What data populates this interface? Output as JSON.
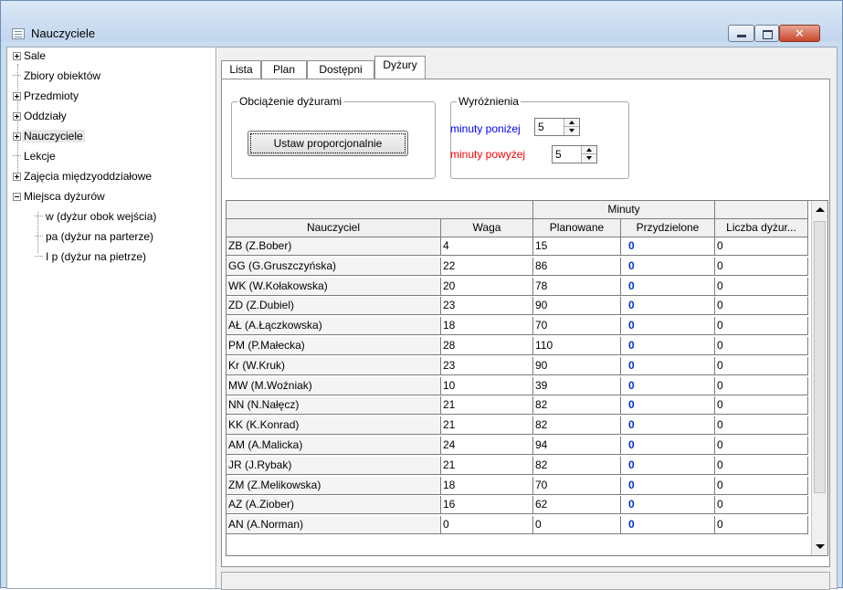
{
  "window": {
    "title": "Nauczyciele"
  },
  "tree": {
    "items": [
      {
        "label": "Sale",
        "expander": "plus"
      },
      {
        "label": "Zbiory obiektów",
        "expander": "line"
      },
      {
        "label": "Przedmioty",
        "expander": "plus"
      },
      {
        "label": "Oddziały",
        "expander": "plus"
      },
      {
        "label": "Nauczyciele",
        "expander": "plus",
        "selected": true
      },
      {
        "label": "Lekcje",
        "expander": "line"
      },
      {
        "label": "Zajęcia międzyoddziałowe",
        "expander": "plus"
      },
      {
        "label": "Miejsca dyżurów",
        "expander": "minus"
      },
      {
        "label": "w (dyżur obok wejścia)",
        "expander": "child"
      },
      {
        "label": "pa (dyżur na parterze)",
        "expander": "child"
      },
      {
        "label": "I p (dyżur na pietrze)",
        "expander": "child"
      }
    ]
  },
  "tabs": [
    {
      "label": "Lista"
    },
    {
      "label": "Plan"
    },
    {
      "label": "Dostępni"
    },
    {
      "label": "Dyżury",
      "active": true
    }
  ],
  "load_group": {
    "title": "Obciążenie dyżurami",
    "button": "Ustaw proporcjonalnie"
  },
  "highlight_group": {
    "title": "Wyróżnienia",
    "below_label": "minuty poniżej",
    "below_value": "5",
    "above_label": "minuty powyżej",
    "above_value": "5",
    "below_color": "#0000ff",
    "above_color": "#ff0000"
  },
  "grid": {
    "group_header": "Minuty",
    "columns": [
      "Nauczyciel",
      "Waga",
      "Planowane",
      "Przydzielone",
      "Liczba dyżur..."
    ],
    "rows": [
      [
        "ZB (Z.Bober)",
        "4",
        "15",
        "0",
        "0"
      ],
      [
        "GG (G.Gruszczyńska)",
        "22",
        "86",
        "0",
        "0"
      ],
      [
        "WK (W.Kołakowska)",
        "20",
        "78",
        "0",
        "0"
      ],
      [
        "ZD (Z.Dubiel)",
        "23",
        "90",
        "0",
        "0"
      ],
      [
        "AŁ (A.Łączkowska)",
        "18",
        "70",
        "0",
        "0"
      ],
      [
        "PM (P.Małecka)",
        "28",
        "110",
        "0",
        "0"
      ],
      [
        "Kr (W.Kruk)",
        "23",
        "90",
        "0",
        "0"
      ],
      [
        "MW (M.Woźniak)",
        "10",
        "39",
        "0",
        "0"
      ],
      [
        "NN (N.Nałęcz)",
        "21",
        "82",
        "0",
        "0"
      ],
      [
        "KK (K.Konrad)",
        "21",
        "82",
        "0",
        "0"
      ],
      [
        "AM (A.Malicka)",
        "24",
        "94",
        "0",
        "0"
      ],
      [
        "JR (J.Rybak)",
        "21",
        "82",
        "0",
        "0"
      ],
      [
        "ZM (Z.Melikowska)",
        "18",
        "70",
        "0",
        "0"
      ],
      [
        "AZ (A.Ziober)",
        "16",
        "62",
        "0",
        "0"
      ],
      [
        "AN (A.Norman)",
        "0",
        "0",
        "0",
        "0"
      ]
    ]
  }
}
